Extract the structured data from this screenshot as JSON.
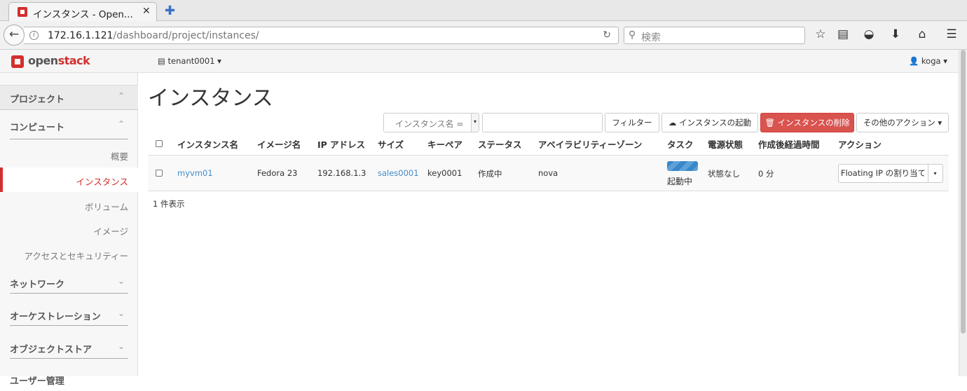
{
  "browser": {
    "tab_title": "インスタンス - Open...",
    "tab_close": "✕",
    "new_tab": "✚",
    "url_host": "172.16.1.121",
    "url_path": "/dashboard/project/instances/",
    "search_placeholder": "検索",
    "icons": [
      "back-arrow-icon",
      "info-icon",
      "reload-icon",
      "search-icon",
      "bookmark-star-icon",
      "reading-list-icon",
      "pocket-icon",
      "download-icon",
      "home-icon",
      "menu-icon"
    ]
  },
  "header": {
    "brand_open": "open",
    "brand_stack": "stack",
    "project_selector": "tenant0001",
    "user_menu": "koga"
  },
  "sidebar": {
    "project": "プロジェクト",
    "compute": "コンピュート",
    "items": [
      "概要",
      "インスタンス",
      "ボリューム",
      "イメージ",
      "アクセスとセキュリティー"
    ],
    "active_item": "インスタンス",
    "network": "ネットワーク",
    "orchestration": "オーケストレーション",
    "object_store": "オブジェクトストア",
    "admin_partial": "ユーザー管理"
  },
  "main": {
    "title": "インスタンス",
    "filter_field": "インスタンス名 =",
    "filter_value": "",
    "filter_button": "フィルター",
    "launch_button": "インスタンスの起動",
    "delete_button": "インスタンスの削除",
    "more_actions": "その他のアクション",
    "columns": [
      "インスタンス名",
      "イメージ名",
      "IP アドレス",
      "サイズ",
      "キーペア",
      "ステータス",
      "アベイラビリティーゾーン",
      "タスク",
      "電源状態",
      "作成後経過時間",
      "アクション"
    ],
    "rows": [
      {
        "name": "myvm01",
        "image": "Fedora 23",
        "ip": "192.168.1.3",
        "size": "sales0001",
        "keypair": "key0001",
        "status": "作成中",
        "zone": "nova",
        "task": "起動中",
        "power": "状態なし",
        "age": "0 分",
        "action": "Floating IP の割り当て"
      }
    ],
    "count": "1 件表示"
  },
  "colors": {
    "accent": "#d32f2f",
    "link": "#428bca",
    "danger": "#d9534f"
  }
}
